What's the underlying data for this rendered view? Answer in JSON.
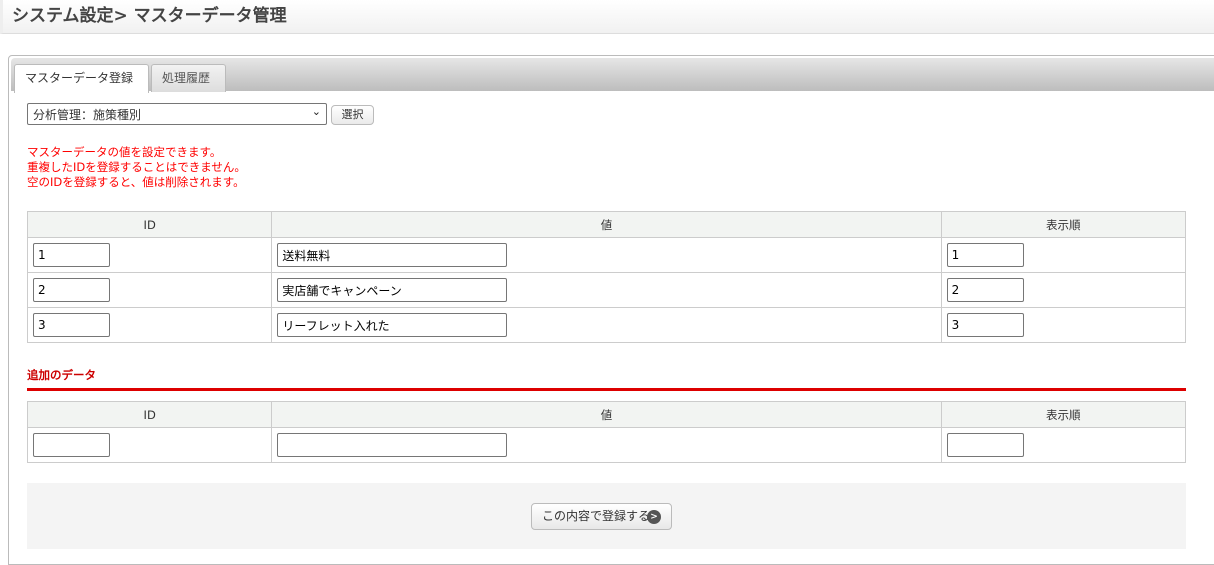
{
  "header": {
    "title": "システム設定> マスターデータ管理"
  },
  "tabs": [
    {
      "label": "マスターデータ登録",
      "active": true
    },
    {
      "label": "処理履歴",
      "active": false
    }
  ],
  "selector": {
    "value": "分析管理：施策種別",
    "button": "選択"
  },
  "notes": [
    "マスターデータの値を設定できます。",
    "重複したIDを登録することはできません。",
    "空のIDを登録すると、値は削除されます。"
  ],
  "table": {
    "headers": [
      "ID",
      "値",
      "表示順"
    ],
    "rows": [
      {
        "id": "1",
        "value": "送料無料",
        "order": "1"
      },
      {
        "id": "2",
        "value": "実店舗でキャンペーン",
        "order": "2"
      },
      {
        "id": "3",
        "value": "リーフレット入れた",
        "order": "3"
      }
    ]
  },
  "add_section": {
    "title": "追加のデータ",
    "headers": [
      "ID",
      "値",
      "表示順"
    ]
  },
  "submit": {
    "label": "この内容で登録する"
  },
  "colors": {
    "notes": "#ff0000",
    "section": "#cc0000"
  }
}
